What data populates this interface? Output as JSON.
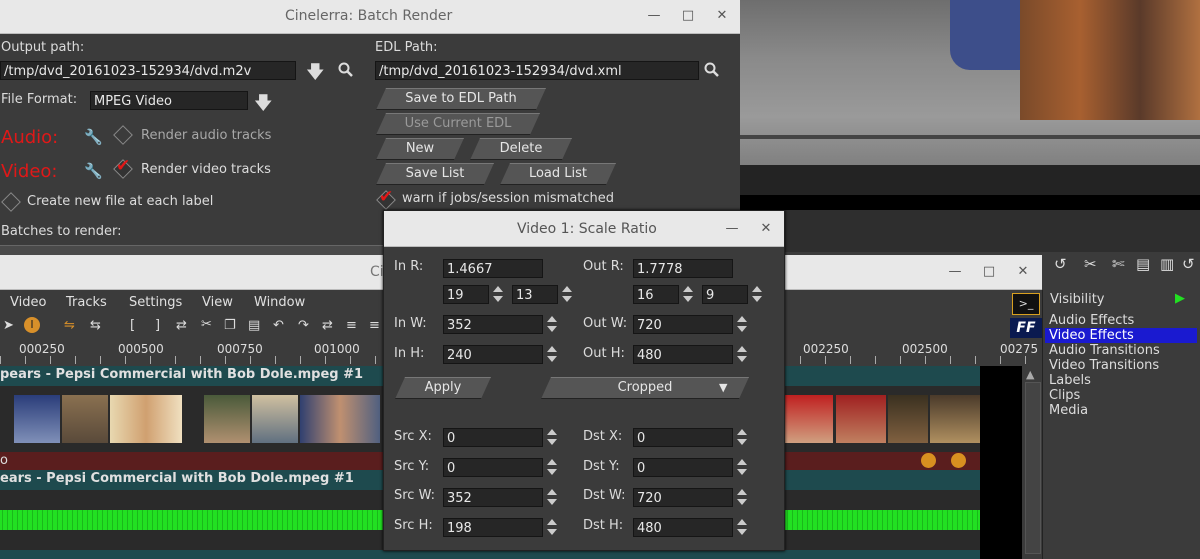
{
  "batch_render": {
    "title": "Cinelerra: Batch Render",
    "output_path_label": "Output path:",
    "output_path_value": "/tmp/dvd_20161023-152934/dvd.m2v",
    "file_format_label": "File Format:",
    "file_format_value": "MPEG Video",
    "audio_label": "Audio:",
    "render_audio_label": "Render audio tracks",
    "video_label": "Video:",
    "render_video_label": "Render video tracks",
    "create_new_file_label": "Create new file at each label",
    "batches_label": "Batches to render:",
    "edl_path_label": "EDL Path:",
    "edl_path_value": "/tmp/dvd_20161023-152934/dvd.xml",
    "save_to_edl": "Save to EDL Path",
    "use_current_edl": "Use Current EDL",
    "new": "New",
    "delete": "Delete",
    "save_list": "Save List",
    "load_list": "Load List",
    "warn_label": "warn if jobs/session mismatched"
  },
  "main_window": {
    "title_fragment": "Ci",
    "menu": [
      "Video",
      "Tracks",
      "Settings",
      "View",
      "Window"
    ],
    "ruler": [
      "000250",
      "000500",
      "000750",
      "001000",
      "002250",
      "002500",
      "00275"
    ],
    "track1_title": "pears - Pepsi Commercial with Bob Dole.mpeg #1",
    "track2_title": "ears - Pepsi Commercial with Bob Dole.mpeg #1",
    "track_letter": "o"
  },
  "scale_ratio": {
    "title": "Video 1: Scale Ratio",
    "in_r_label": "In R:",
    "in_r": "1.4667",
    "out_r_label": "Out R:",
    "out_r": "1.7778",
    "in_num": "19",
    "in_den": "13",
    "out_num": "16",
    "out_den": "9",
    "in_w_label": "In W:",
    "in_w": "352",
    "out_w_label": "Out W:",
    "out_w": "720",
    "in_h_label": "In H:",
    "in_h": "240",
    "out_h_label": "Out H:",
    "out_h": "480",
    "apply": "Apply",
    "mode": "Cropped",
    "src_x_label": "Src X:",
    "src_x": "0",
    "dst_x_label": "Dst X:",
    "dst_x": "0",
    "src_y_label": "Src Y:",
    "src_y": "0",
    "dst_y_label": "Dst Y:",
    "dst_y": "0",
    "src_w_label": "Src W:",
    "src_w": "352",
    "dst_w_label": "Dst W:",
    "dst_w": "720",
    "src_h_label": "Src H:",
    "src_h": "198",
    "dst_h_label": "Dst H:",
    "dst_h": "480"
  },
  "resources": {
    "visibility_label": "Visibility",
    "items": [
      "Audio Effects",
      "Video Effects",
      "Audio Transitions",
      "Video Transitions",
      "Labels",
      "Clips",
      "Media"
    ],
    "selected": "Video Effects"
  },
  "colors": {
    "accent_selected": "#1a1ad0",
    "waveform": "#22e022",
    "track_title_bg": "#1e4a4e",
    "red_label": "#e01818"
  }
}
